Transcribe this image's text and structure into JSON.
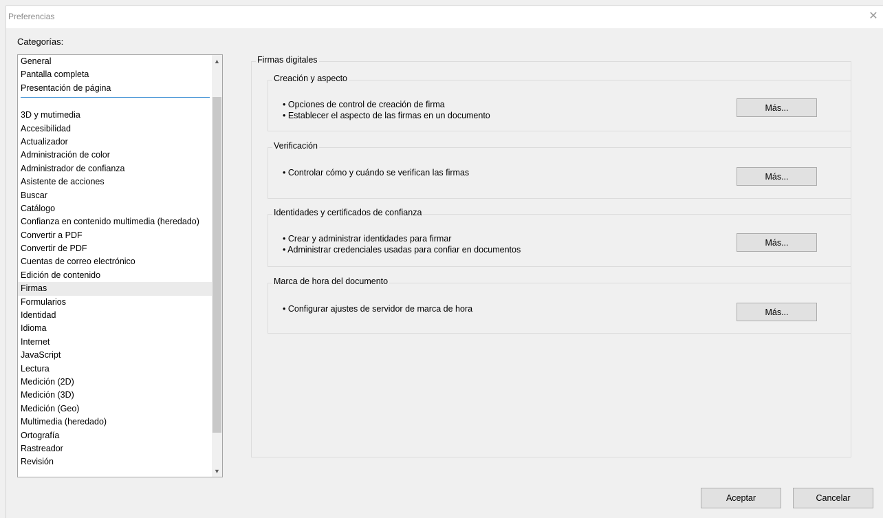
{
  "window": {
    "title": "Preferencias"
  },
  "categories": {
    "label": "Categorías:",
    "top_items": [
      "General",
      "Pantalla completa",
      "Presentación de página"
    ],
    "items": [
      "3D y mutimedia",
      "Accesibilidad",
      "Actualizador",
      "Administración de color",
      "Administrador de confianza",
      "Asistente de acciones",
      "Buscar",
      "Catálogo",
      "Confianza en contenido multimedia (heredado)",
      "Convertir a PDF",
      "Convertir de PDF",
      "Cuentas de correo electrónico",
      "Edición de contenido",
      "Firmas",
      "Formularios",
      "Identidad",
      "Idioma",
      "Internet",
      "JavaScript",
      "Lectura",
      "Medición (2D)",
      "Medición (3D)",
      "Medición (Geo)",
      "Multimedia (heredado)",
      "Ortografía",
      "Rastreador",
      "Revisión"
    ],
    "selected": "Firmas"
  },
  "main": {
    "group_title": "Firmas digitales",
    "sections": [
      {
        "title": "Creación y aspecto",
        "bullets": [
          "• Opciones de control de creación de firma",
          "• Establecer el aspecto de las firmas en un documento"
        ],
        "button": "Más..."
      },
      {
        "title": "Verificación",
        "bullets": [
          "• Controlar cómo y cuándo se verifican las firmas"
        ],
        "button": "Más..."
      },
      {
        "title": "Identidades y certificados de confianza",
        "bullets": [
          "• Crear y administrar identidades para firmar",
          "• Administrar credenciales usadas para confiar en documentos"
        ],
        "button": "Más..."
      },
      {
        "title": "Marca de hora del documento",
        "bullets": [
          "• Configurar ajustes de servidor de marca de hora"
        ],
        "button": "Más..."
      }
    ]
  },
  "footer": {
    "ok": "Aceptar",
    "cancel": "Cancelar"
  },
  "icons": {
    "close": "close-icon",
    "scroll_up": "chevron-up-icon",
    "scroll_down": "chevron-down-icon"
  }
}
